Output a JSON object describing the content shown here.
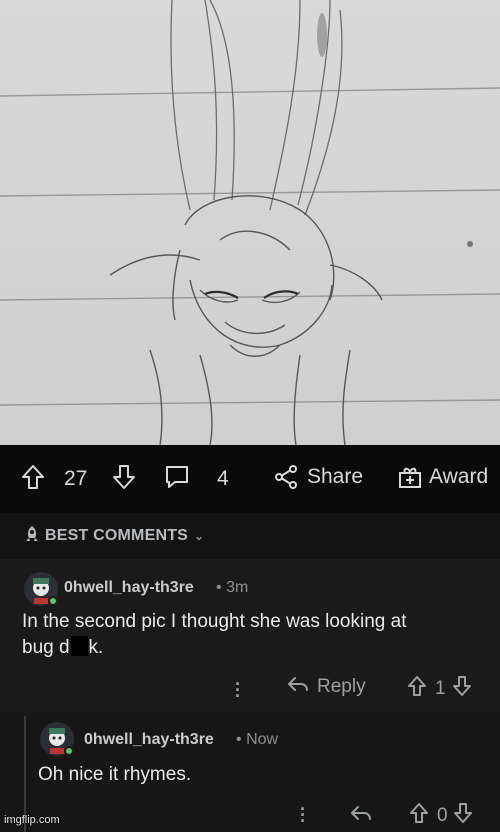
{
  "post": {
    "image_description_alt": "",
    "upvote_count": "27",
    "comment_count": "4",
    "share_label": "Share",
    "award_label": "Award"
  },
  "sort": {
    "label": "BEST COMMENTS"
  },
  "comments": [
    {
      "username": "0hwell_hay-th3re",
      "separator": "•",
      "time": "3m",
      "text_part1": "In the second pic I thought she was looking at",
      "text_part2_a": "bug d",
      "text_part2_b": "k.",
      "reply_label": "Reply",
      "score": "1"
    },
    {
      "username": "0hwell_hay-th3re",
      "separator": "•",
      "time": "Now",
      "text": "Oh nice it rhymes.",
      "score": "0"
    }
  ],
  "watermark": "imgflip.com",
  "colors": {
    "background": "#0b0b0c",
    "comment_bg": "#1a1a1b",
    "online_dot": "#46d160",
    "text": "#d7dadc"
  },
  "icons": {
    "upvote": "arrow-up-outline-icon",
    "downvote": "arrow-down-outline-icon",
    "comments": "speech-bubble-icon",
    "share": "share-nodes-icon",
    "award": "gift-icon",
    "sort": "rocket-icon",
    "reply": "reply-arrow-icon",
    "more": "vertical-dots-icon"
  }
}
